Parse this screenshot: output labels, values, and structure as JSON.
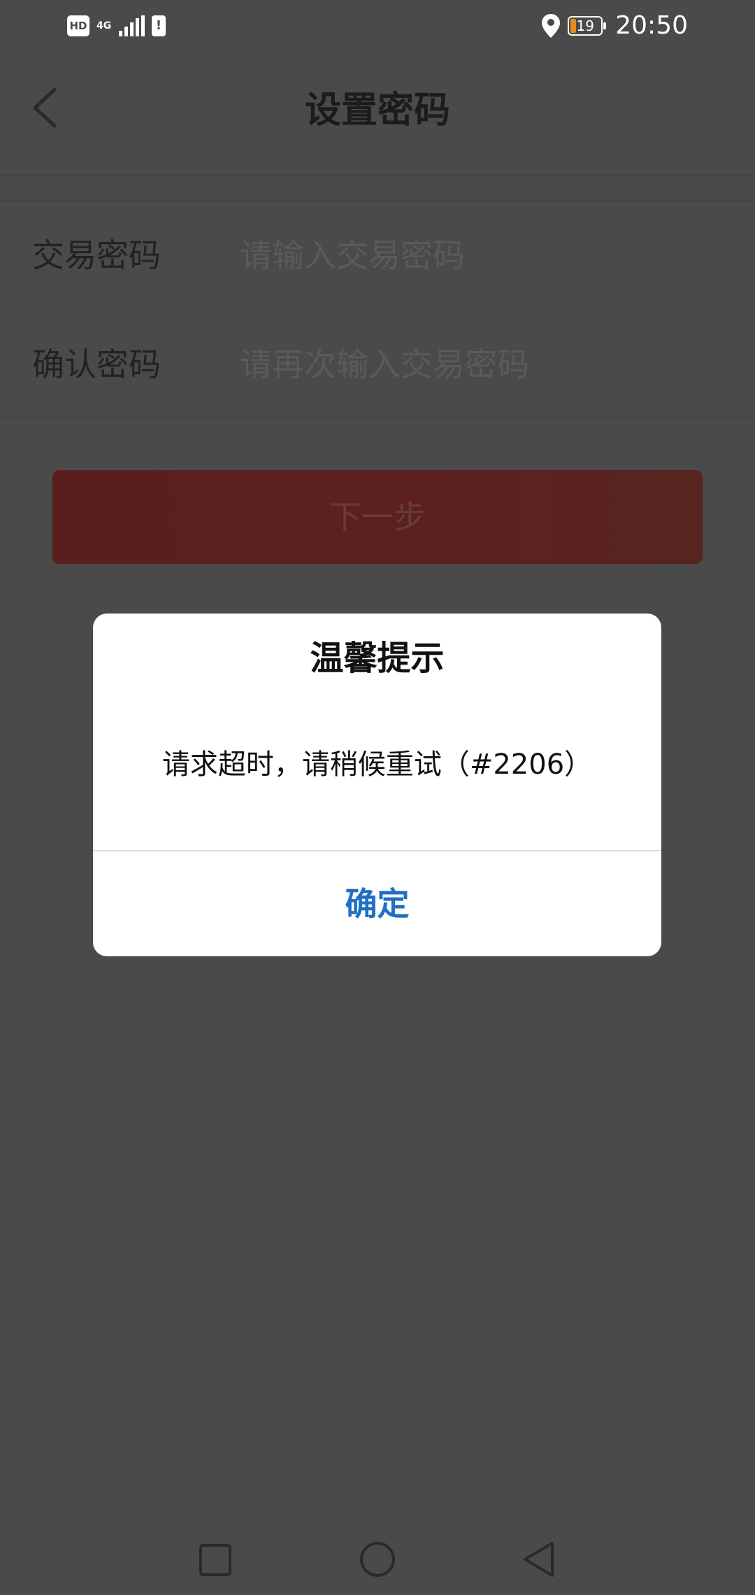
{
  "status_bar": {
    "hd": "HD",
    "network": "4G",
    "alert": "!",
    "battery_level": "19",
    "battery_fraction": 0.19,
    "time": "20:50",
    "icons": [
      "hd-icon",
      "signal-icon",
      "alert-icon",
      "location-icon",
      "battery-icon"
    ]
  },
  "header": {
    "title": "设置密码",
    "back_icon": "chevron-left-icon"
  },
  "form": {
    "trade_password": {
      "label": "交易密码",
      "placeholder": "请输入交易密码",
      "value": ""
    },
    "confirm_password": {
      "label": "确认密码",
      "placeholder": "请再次输入交易密码",
      "value": ""
    }
  },
  "next_button": {
    "label": "下一步"
  },
  "dialog": {
    "title": "温馨提示",
    "message": "请求超时，请稍候重试（#2206）",
    "ok_label": "确定"
  },
  "nav_bar": {
    "icons": [
      "recents-square-icon",
      "home-circle-icon",
      "back-triangle-icon"
    ]
  },
  "colors": {
    "overlay_background": "#4a4a4a",
    "dialog_background": "#ffffff",
    "dialog_button": "#1f6fc4",
    "next_button_dimmed": "#5c2020",
    "battery_fill": "#e58a1c"
  }
}
